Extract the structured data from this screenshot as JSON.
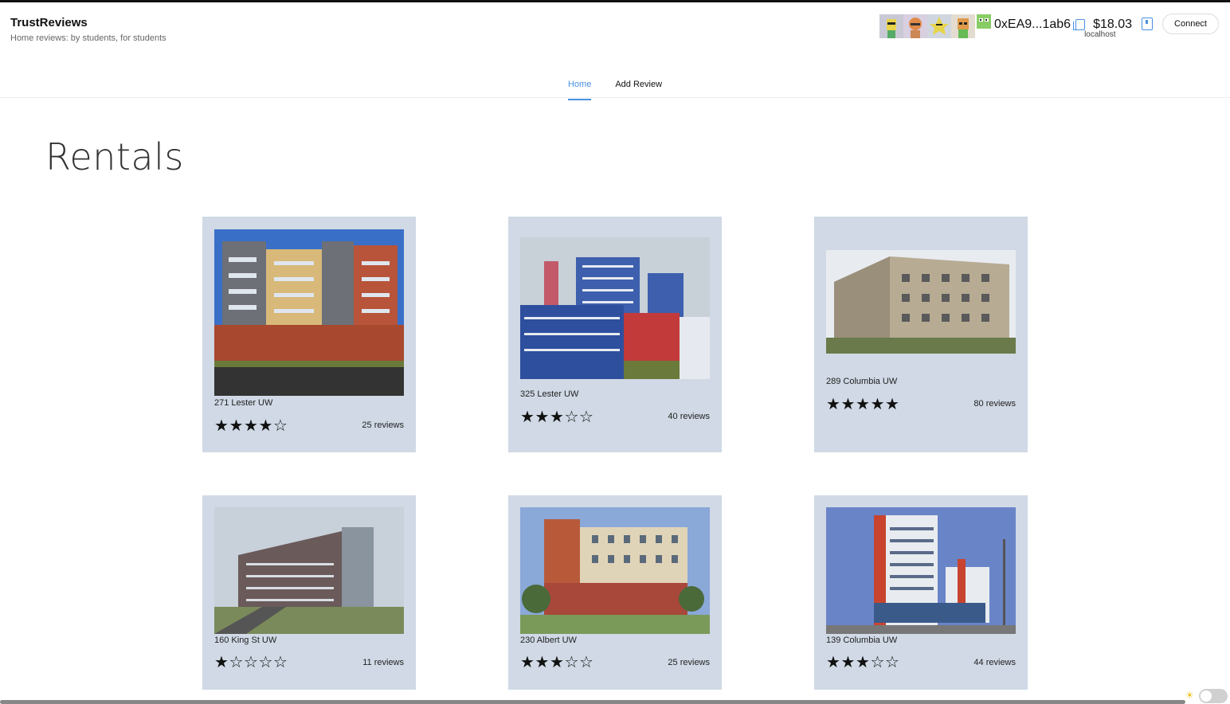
{
  "app": {
    "title": "TrustReviews",
    "subtitle": "Home reviews: by students, for students"
  },
  "wallet": {
    "address": "0xEA9...1ab6",
    "balance": "$18.03",
    "network": "localhost",
    "connect_label": "Connect"
  },
  "nav": {
    "tabs": [
      {
        "label": "Home",
        "active": true
      },
      {
        "label": "Add Review",
        "active": false
      }
    ]
  },
  "page": {
    "title": "Rentals"
  },
  "rentals": [
    {
      "name": "271 Lester UW",
      "rating": 4,
      "max_rating": 5,
      "reviews": "25 reviews"
    },
    {
      "name": "325 Lester UW",
      "rating": 3,
      "max_rating": 5,
      "reviews": "40 reviews"
    },
    {
      "name": "289 Columbia UW",
      "rating": 5,
      "max_rating": 5,
      "reviews": "80 reviews"
    },
    {
      "name": "160 King St UW",
      "rating": 1,
      "max_rating": 5,
      "reviews": "11 reviews"
    },
    {
      "name": "230 Albert UW",
      "rating": 3,
      "max_rating": 5,
      "reviews": "25 reviews"
    },
    {
      "name": "139 Columbia UW",
      "rating": 3,
      "max_rating": 5,
      "reviews": "44 reviews"
    }
  ],
  "colors": {
    "accent": "#4a90e2",
    "card_bg": "#d0d9e5"
  },
  "icons": [
    "copy-icon",
    "wallet-icon",
    "sun-icon",
    "star-filled-icon",
    "star-empty-icon"
  ]
}
